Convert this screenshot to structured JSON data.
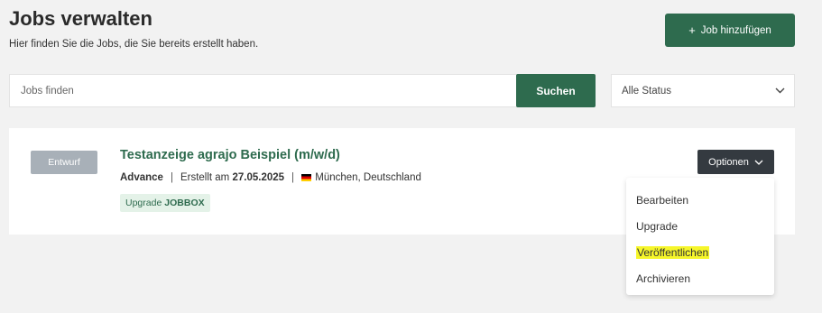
{
  "header": {
    "title": "Jobs verwalten",
    "subtitle": "Hier finden Sie die Jobs, die Sie bereits erstellt haben.",
    "add_button_icon": "+",
    "add_button_label": "Job hinzufügen"
  },
  "search": {
    "placeholder": "Jobs finden",
    "value": "",
    "button_label": "Suchen",
    "status_selected": "Alle Status"
  },
  "job": {
    "status": "Entwurf",
    "title": "Testanzeige agrajo Beispiel (m/w/d)",
    "package": "Advance",
    "created_prefix": "Erstellt am",
    "created_date": "27.05.2025",
    "location": "München, Deutschland",
    "upgrade_prefix": "Upgrade",
    "upgrade_name": "JOBBOX",
    "options_label": "Optionen"
  },
  "options_menu": {
    "items": [
      {
        "label": "Bearbeiten"
      },
      {
        "label": "Upgrade"
      },
      {
        "label": "Veröffentlichen",
        "highlight_color": "#f6f62a"
      },
      {
        "label": "Archivieren"
      }
    ]
  },
  "colors": {
    "accent": "#2e6b4e",
    "draft_badge": "#a8b0b8",
    "options_button": "#343a40",
    "background": "#f2f2f2"
  },
  "icons": {
    "flag": "flag-germany-icon",
    "select_chevron": "chevron-down-icon",
    "options_chevron": "chevron-down-icon"
  }
}
